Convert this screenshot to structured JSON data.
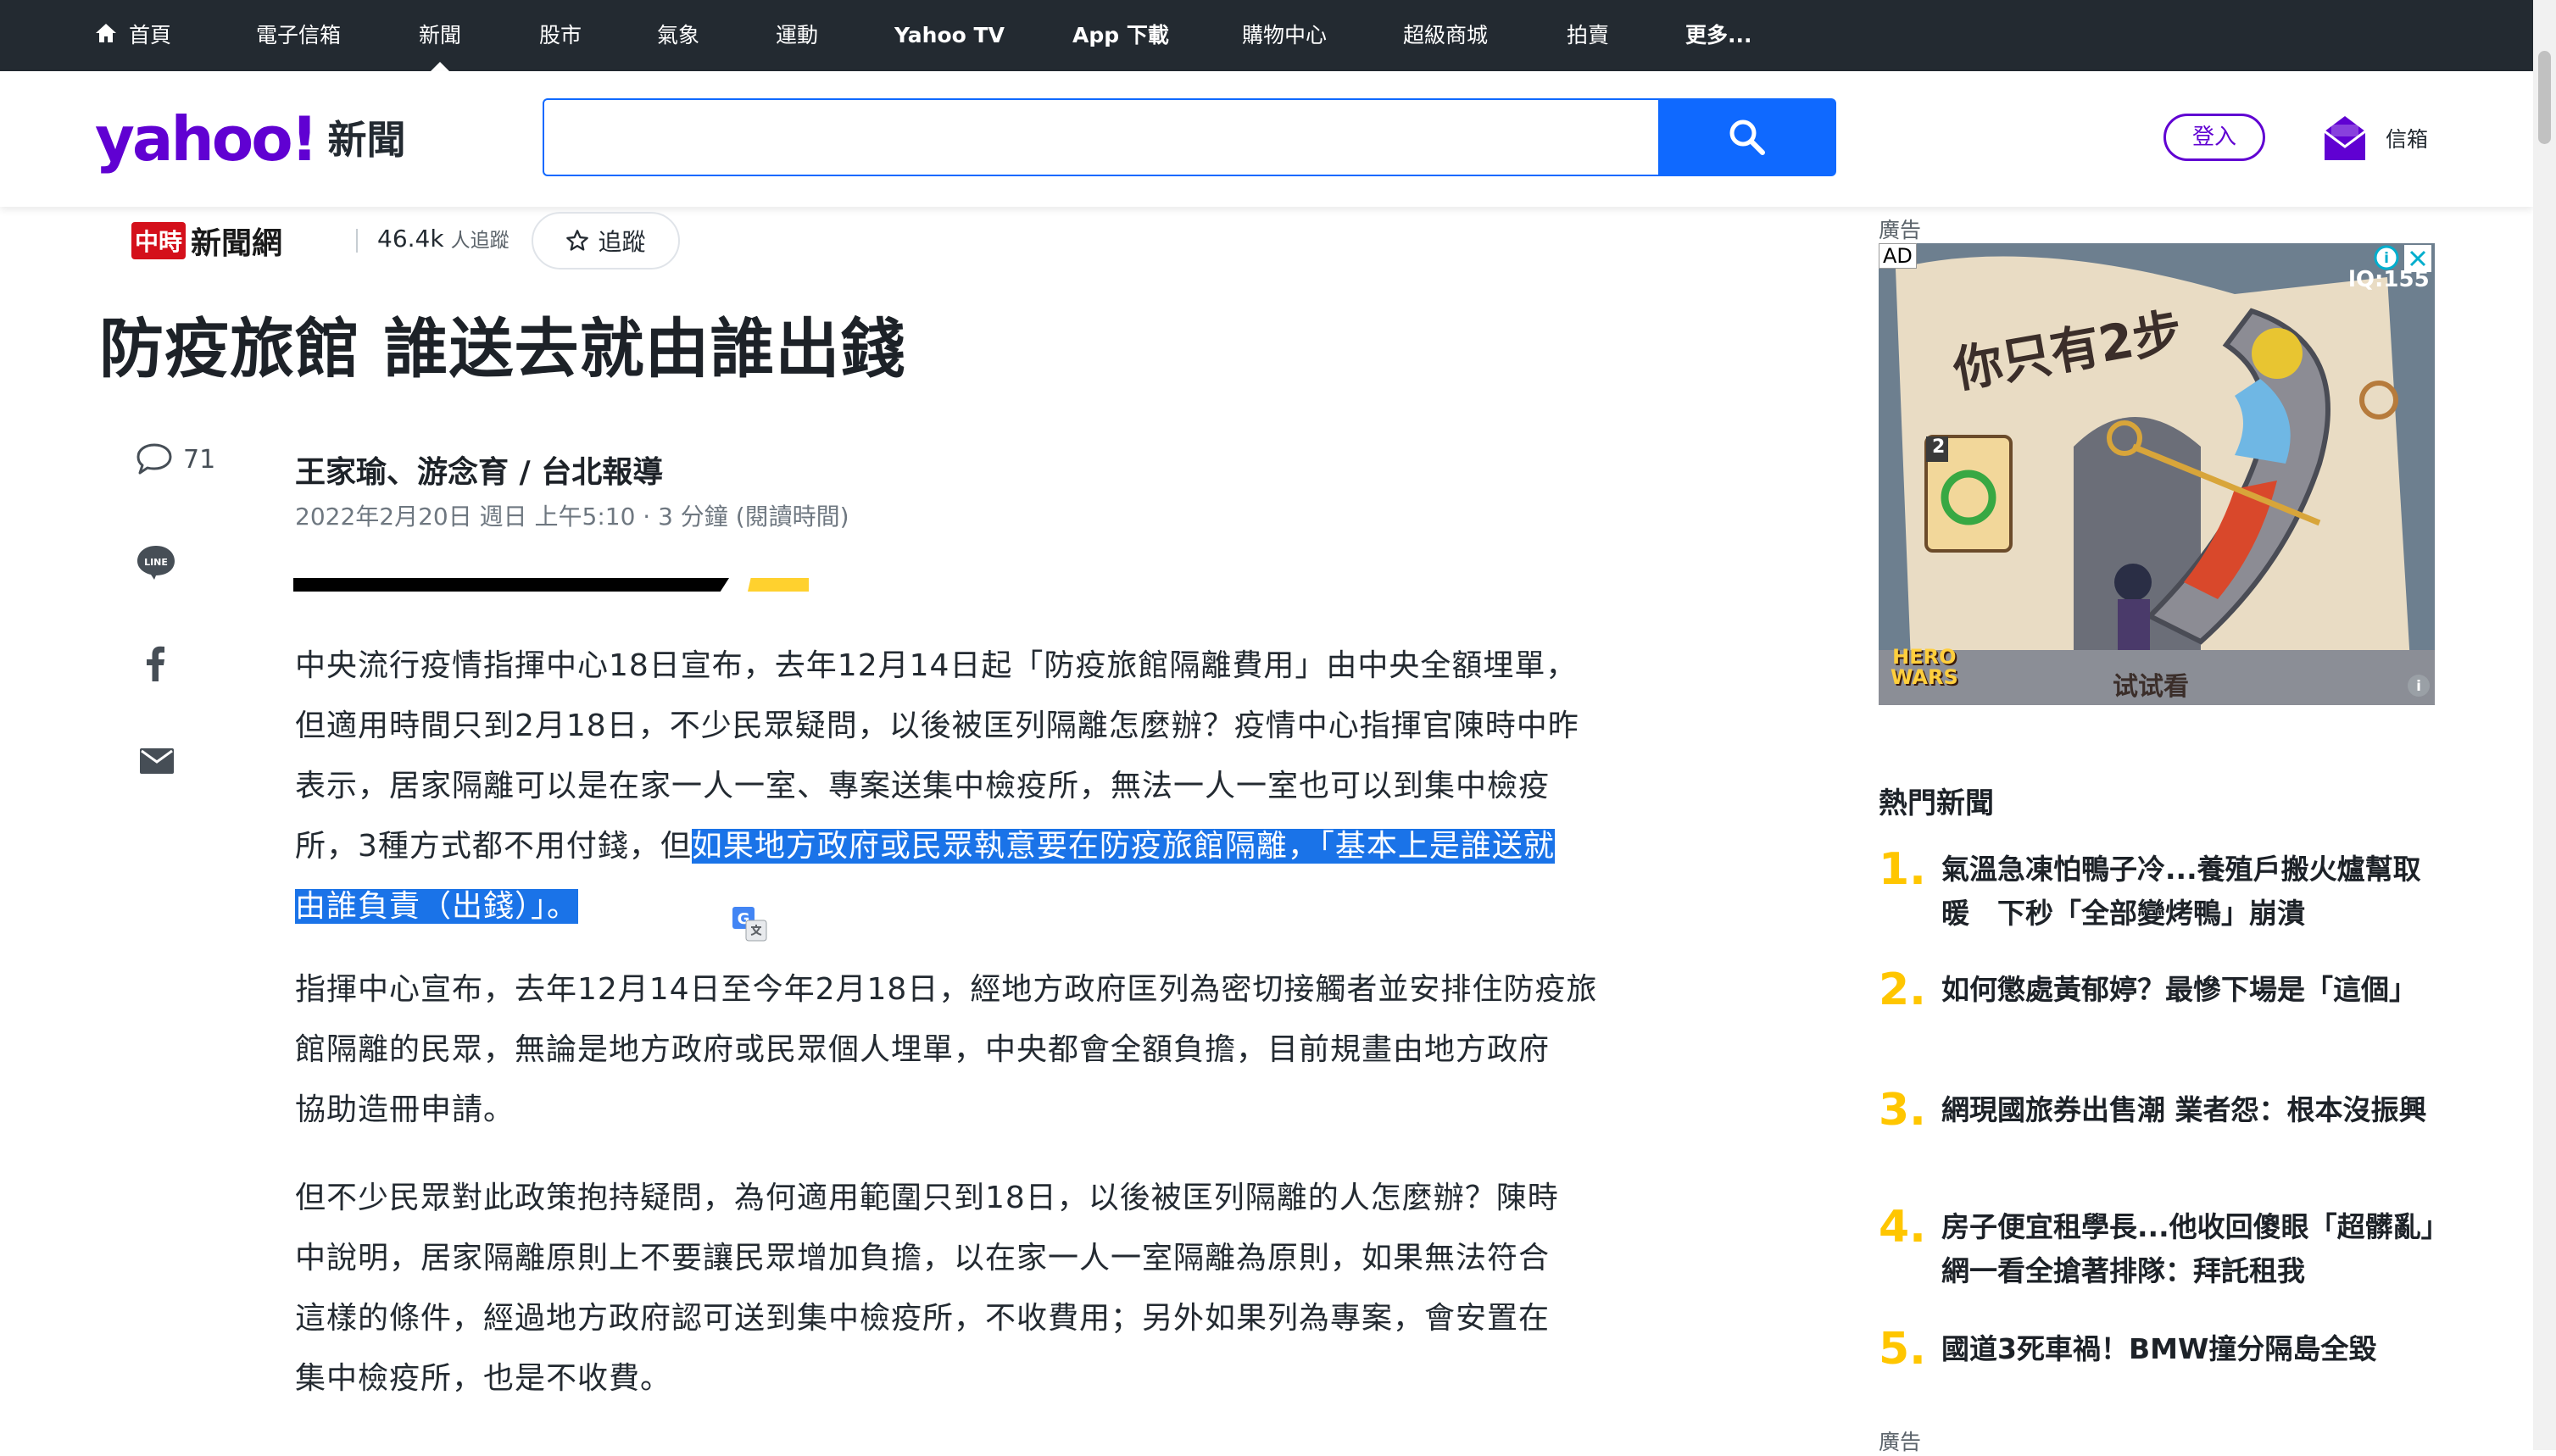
{
  "topnav": {
    "items": [
      {
        "label": "首頁"
      },
      {
        "label": "電子信箱"
      },
      {
        "label": "新聞"
      },
      {
        "label": "股市"
      },
      {
        "label": "氣象"
      },
      {
        "label": "運動"
      },
      {
        "label": "Yahoo TV"
      },
      {
        "label": "App 下載"
      },
      {
        "label": "購物中心"
      },
      {
        "label": "超級商城"
      },
      {
        "label": "拍賣"
      },
      {
        "label": "更多..."
      }
    ],
    "active": "新聞"
  },
  "header": {
    "logo_brand": "yahoo!",
    "logo_section": "新聞",
    "search_placeholder": "",
    "login_label": "登入",
    "mail_label": "信箱"
  },
  "article": {
    "provider_badge": "中時",
    "provider_name": "新聞網",
    "followers_count": "46.4k",
    "followers_suffix": "人追蹤",
    "follow_label": "追蹤",
    "title": "防疫旅館 誰送去就由誰出錢",
    "comment_count": "71",
    "author": "王家瑜、游念育 / 台北報導",
    "dateline": "2022年2月20日 週日 上午5:10 · 3 分鐘 (閱讀時間)",
    "p1_line1": "中央流行疫情指揮中心18日宣布，去年12月14日起「防疫旅館隔離費用」由中央全額埋單，",
    "p1_line2": "但適用時間只到2月18日，不少民眾疑問，以後被匡列隔離怎麼辦？疫情中心指揮官陳時中昨",
    "p1_line3": "表示，居家隔離可以是在家一人一室、專案送集中檢疫所，無法一人一室也可以到集中檢疫",
    "p1_line4_plain": "所，3種方式都不用付錢，但",
    "p1_line4_hl": "如果地方政府或民眾執意要在防疫旅館隔離，「基本上是誰送就",
    "p1_line5_hl": "由誰負責（出錢）」。",
    "p2_line1": "指揮中心宣布，去年12月14日至今年2月18日，經地方政府匡列為密切接觸者並安排住防疫旅",
    "p2_line2": "館隔離的民眾，無論是地方政府或民眾個人埋單，中央都會全額負擔，目前規畫由地方政府",
    "p2_line3": "協助造冊申請。",
    "p3_line1": "但不少民眾對此政策抱持疑問，為何適用範圍只到18日，以後被匡列隔離的人怎麼辦？陳時",
    "p3_line2": "中說明，居家隔離原則上不要讓民眾增加負擔，以在家一人一室隔離為原則，如果無法符合",
    "p3_line3": "這樣的條件，經過地方政府認可送到集中檢疫所，不收費用；另外如果列為專案，會安置在",
    "p3_line4": "集中檢疫所，也是不收費。"
  },
  "sidebar": {
    "ad_label": "廣告",
    "ad_tag": "AD",
    "ad_headline": "你只有2步",
    "ad_level": "lQ:155",
    "ad_cta": "试试看",
    "ad_brand_line1": "HERO",
    "ad_brand_line2": "WARS",
    "ad_card_num": "2",
    "trending_title": "熱門新聞",
    "trending": [
      {
        "num": "1.",
        "text": "氣溫急凍怕鴨子冷...養殖戶搬火爐幫取暖　下秒「全部變烤鴨」崩潰"
      },
      {
        "num": "2.",
        "text": "如何懲處黃郁婷？最慘下場是「這個」"
      },
      {
        "num": "3.",
        "text": "網現國旅券出售潮 業者怨：根本沒振興"
      },
      {
        "num": "4.",
        "text": "房子便宜租學長...他收回傻眼「超髒亂」　網一看全搶著排隊：拜託租我"
      },
      {
        "num": "5.",
        "text": "國道3死車禍！BMW撞分隔島全毀"
      }
    ],
    "ad_label_bottom": "廣告"
  },
  "colors": {
    "nav_bg": "#232a31",
    "brand_purple": "#6001d2",
    "search_blue": "#0f69ff",
    "highlight": "#1a73e8",
    "trend_number": "#ffc600",
    "accent_yellow": "#ffd12e"
  }
}
